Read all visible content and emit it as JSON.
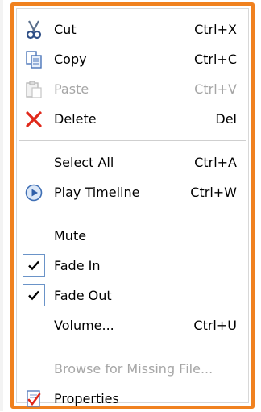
{
  "menu": {
    "items": [
      {
        "label": "Cut",
        "shortcut": "Ctrl+X",
        "icon": "scissors-icon",
        "enabled": true
      },
      {
        "label": "Copy",
        "shortcut": "Ctrl+C",
        "icon": "copy-icon",
        "enabled": true
      },
      {
        "label": "Paste",
        "shortcut": "Ctrl+V",
        "icon": "paste-icon",
        "enabled": false
      },
      {
        "label": "Delete",
        "shortcut": "Del",
        "icon": "delete-icon",
        "enabled": true
      },
      {
        "label": "Select All",
        "shortcut": "Ctrl+A",
        "icon": "",
        "enabled": true
      },
      {
        "label": "Play Timeline",
        "shortcut": "Ctrl+W",
        "icon": "play-icon",
        "enabled": true
      },
      {
        "label": "Mute",
        "shortcut": "",
        "icon": "",
        "enabled": true
      },
      {
        "label": "Fade In",
        "shortcut": "",
        "icon": "checkmark-icon",
        "checked": true,
        "enabled": true
      },
      {
        "label": "Fade Out",
        "shortcut": "",
        "icon": "checkmark-icon",
        "checked": true,
        "enabled": true
      },
      {
        "label": "Volume...",
        "shortcut": "Ctrl+U",
        "icon": "",
        "enabled": true
      },
      {
        "label": "Browse for Missing File...",
        "shortcut": "",
        "icon": "",
        "enabled": false
      },
      {
        "label": "Properties",
        "shortcut": "",
        "icon": "properties-icon",
        "enabled": true
      }
    ]
  },
  "colors": {
    "border_accent": "#f0811f",
    "disabled_text": "#a6a6a6",
    "delete_red": "#e0281a",
    "check_border": "#6a93c8"
  }
}
